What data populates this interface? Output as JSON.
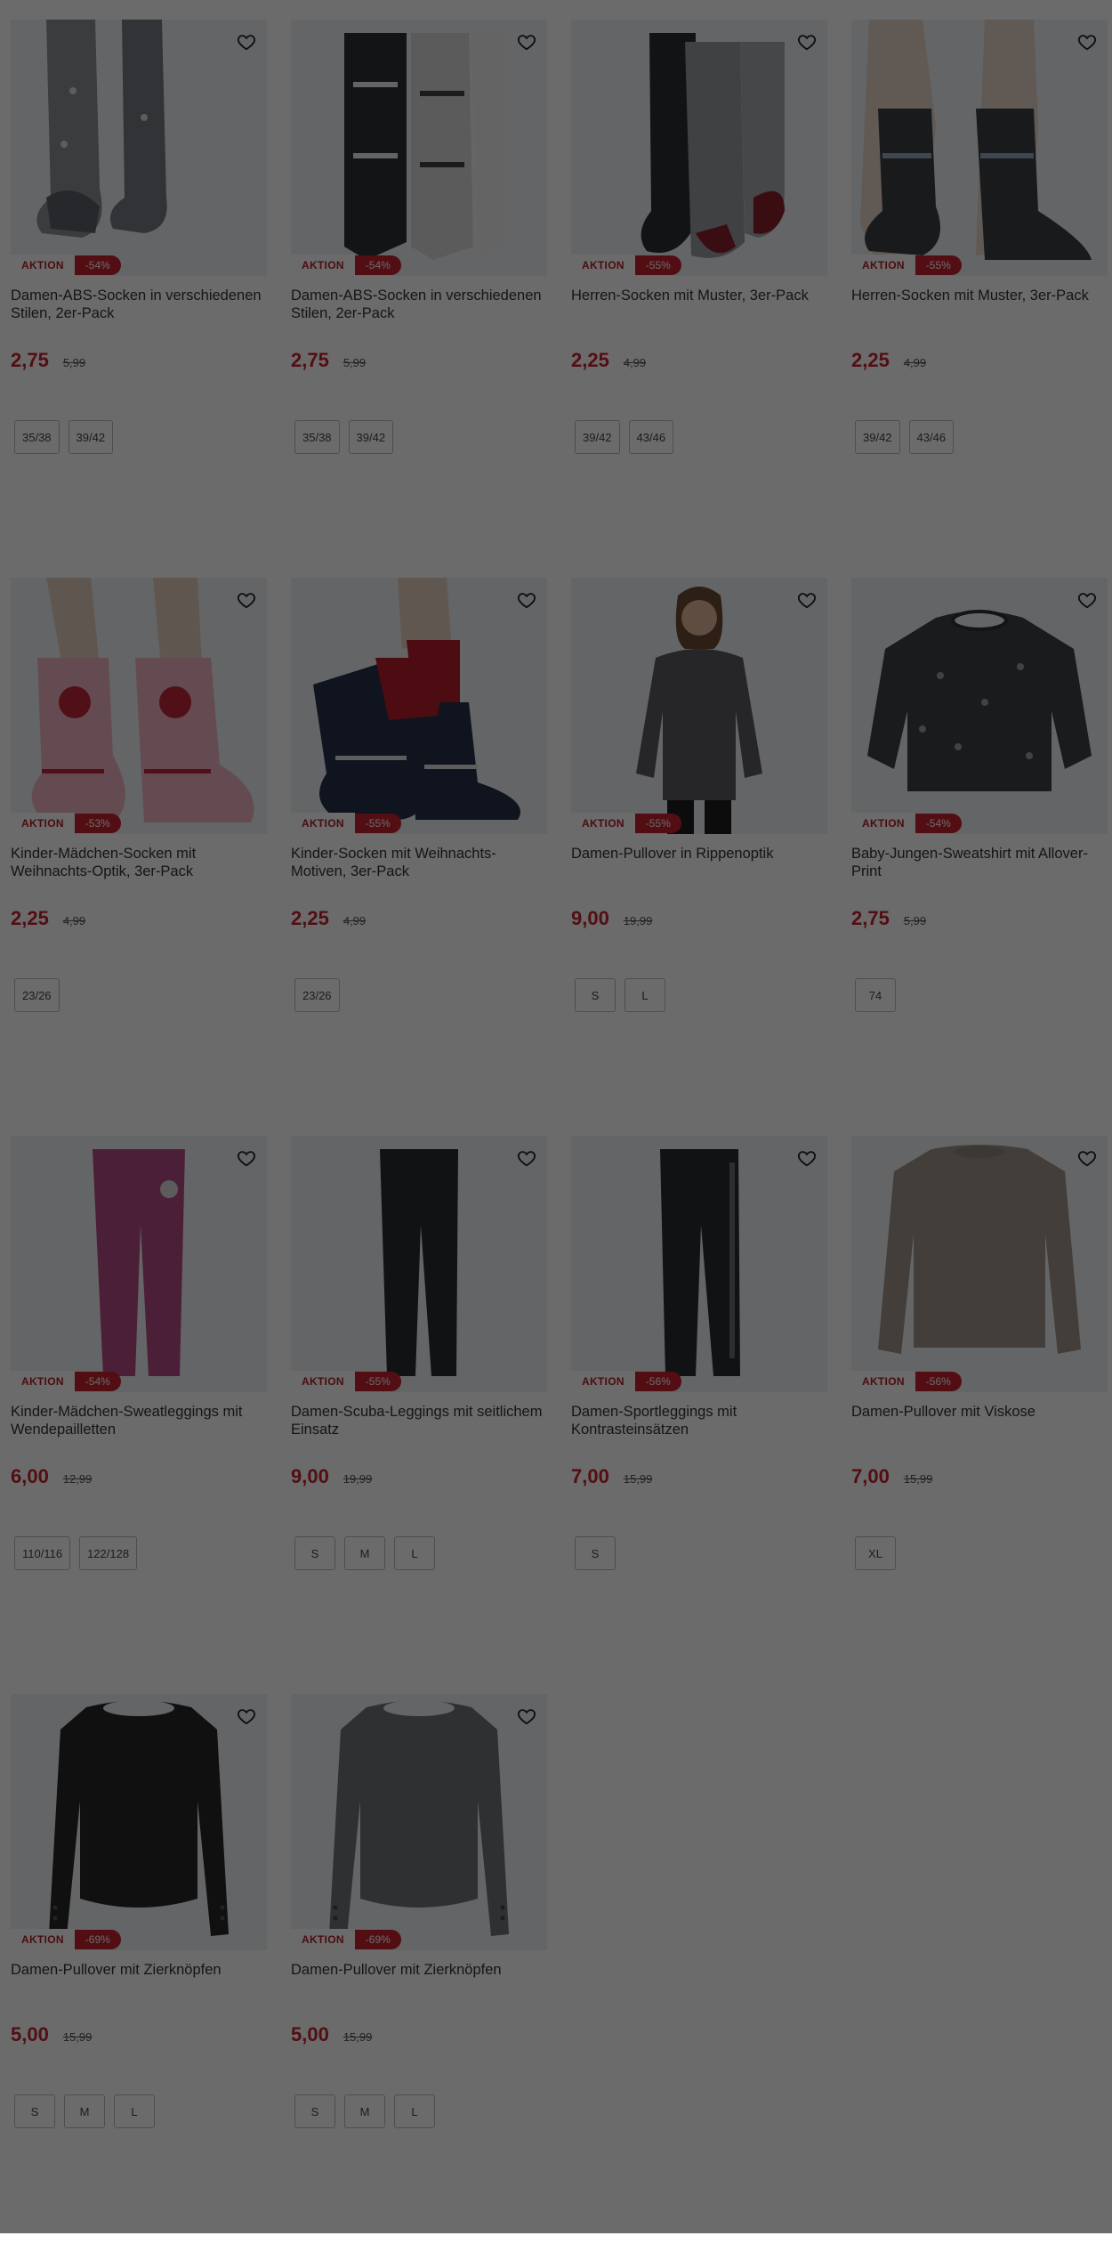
{
  "badge_label": "AKTION",
  "products": [
    {
      "title": "Damen-ABS-Socken in verschiedenen Stilen, 2er-Pack",
      "price": "2,75",
      "old_price": "5,99",
      "discount": "-54%",
      "sizes": [
        "35/38",
        "39/42"
      ],
      "image": "socks-grey-pattern"
    },
    {
      "title": "Damen-ABS-Socken in verschiedenen Stilen, 2er-Pack",
      "price": "2,75",
      "old_price": "5,99",
      "discount": "-54%",
      "sizes": [
        "35/38",
        "39/42"
      ],
      "image": "socks-nordic-pair"
    },
    {
      "title": "Herren-Socken mit Muster, 3er-Pack",
      "price": "2,25",
      "old_price": "4,99",
      "discount": "-55%",
      "sizes": [
        "39/42",
        "43/46"
      ],
      "image": "socks-moose-three"
    },
    {
      "title": "Herren-Socken mit Muster, 3er-Pack",
      "price": "2,25",
      "old_price": "4,99",
      "discount": "-55%",
      "sizes": [
        "39/42",
        "43/46"
      ],
      "image": "socks-fairisle-worn"
    },
    {
      "title": "Kinder-Mädchen-Socken mit Weihnachts-Optik, 3er-Pack",
      "price": "2,25",
      "old_price": "4,99",
      "discount": "-53%",
      "sizes": [
        "23/26"
      ],
      "image": "socks-pink-penguin"
    },
    {
      "title": "Kinder-Socken mit Weihnachts-Motiven, 3er-Pack",
      "price": "2,25",
      "old_price": "4,99",
      "discount": "-55%",
      "sizes": [
        "23/26"
      ],
      "image": "socks-red-navy"
    },
    {
      "title": "Damen-Pullover in Rippenoptik",
      "price": "9,00",
      "old_price": "19,99",
      "discount": "-55%",
      "sizes": [
        "S",
        "L"
      ],
      "image": "woman-grey-sweater"
    },
    {
      "title": "Baby-Jungen-Sweatshirt mit Allover-Print",
      "price": "2,75",
      "old_price": "5,99",
      "discount": "-54%",
      "sizes": [
        "74"
      ],
      "image": "baby-sweatshirt-print"
    },
    {
      "title": "Kinder-Mädchen-Sweatleggings mit Wendepailletten",
      "price": "6,00",
      "old_price": "12,99",
      "discount": "-54%",
      "sizes": [
        "110/116",
        "122/128"
      ],
      "image": "pink-leggings"
    },
    {
      "title": "Damen-Scuba-Leggings mit seitlichem Einsatz",
      "price": "9,00",
      "old_price": "19,99",
      "discount": "-55%",
      "sizes": [
        "S",
        "M",
        "L"
      ],
      "image": "black-leggings"
    },
    {
      "title": "Damen-Sportleggings mit Kontrasteinsätzen",
      "price": "7,00",
      "old_price": "15,99",
      "discount": "-56%",
      "sizes": [
        "S"
      ],
      "image": "black-sport-leggings"
    },
    {
      "title": "Damen-Pullover mit Viskose",
      "price": "7,00",
      "old_price": "15,99",
      "discount": "-56%",
      "sizes": [
        "XL"
      ],
      "image": "beige-pullover"
    },
    {
      "title": "Damen-Pullover mit Zierknöpfen",
      "price": "5,00",
      "old_price": "15,99",
      "discount": "-69%",
      "sizes": [
        "S",
        "M",
        "L"
      ],
      "image": "black-longsleeve"
    },
    {
      "title": "Damen-Pullover mit Zierknöpfen",
      "price": "5,00",
      "old_price": "15,99",
      "discount": "-69%",
      "sizes": [
        "S",
        "M",
        "L"
      ],
      "image": "grey-longsleeve"
    }
  ],
  "colors": {
    "price": "#c4222e",
    "overlay": "rgba(0,0,0,0.58)"
  }
}
